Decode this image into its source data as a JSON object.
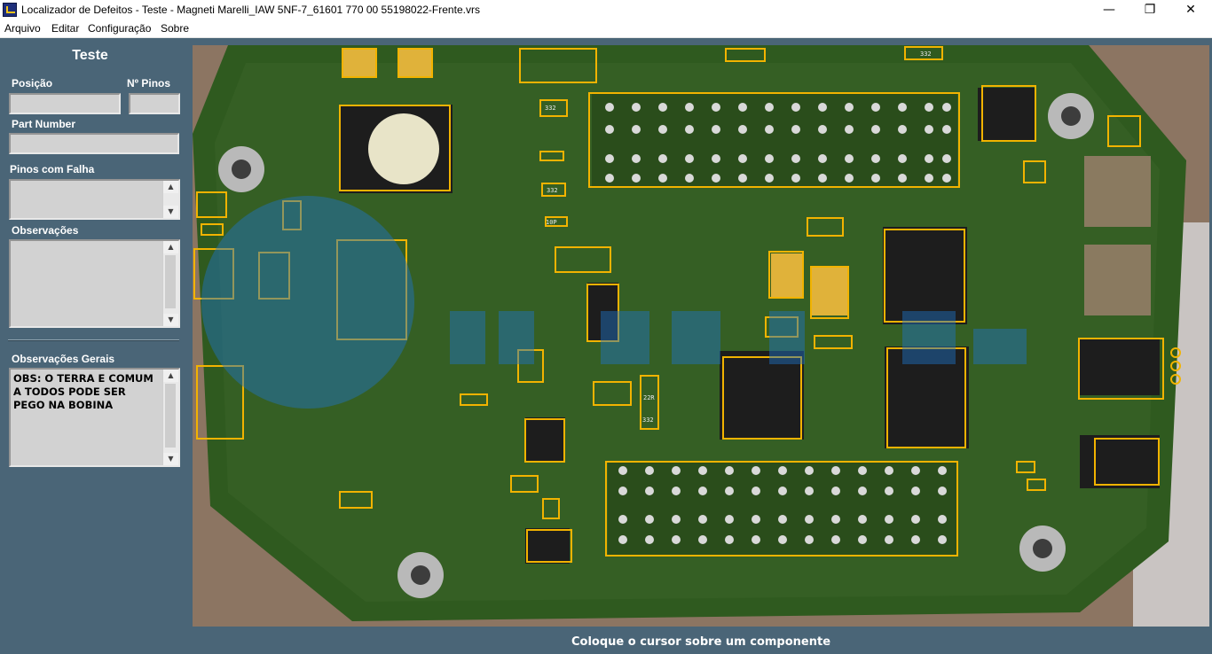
{
  "window": {
    "title": "Localizador de Defeitos - Teste - Magneti Marelli_IAW 5NF-7_61601 770 00 55198022-Frente.vrs",
    "minimize": "—",
    "maximize": "❐",
    "close": "✕"
  },
  "menu": {
    "items": [
      {
        "label": "Arquivo"
      },
      {
        "label": "Editar"
      },
      {
        "label": "Configuração"
      },
      {
        "label": "Sobre"
      }
    ]
  },
  "left_panel": {
    "title": "Teste",
    "position_label": "Posição",
    "position_value": "",
    "pins_label": "Nº Pinos",
    "pins_value": "",
    "part_number_label": "Part Number",
    "part_number_value": "",
    "failing_pins_label": "Pinos com Falha",
    "failing_pins_value": "",
    "observations_label": "Observações",
    "observations_value": "",
    "general_observations_label": "Observações Gerais",
    "general_observations_value": "OBS: O TERRA E COMUM A TODOS PODE SER PEGO NA BOBINA"
  },
  "board": {
    "highlight_color": "#f2b300",
    "pcb_color": "#2f5a1f",
    "chip_labels": [
      "332",
      "332",
      "332",
      "10P",
      "22R",
      "332"
    ]
  },
  "status": {
    "message": "Coloque o cursor sobre um componente"
  }
}
